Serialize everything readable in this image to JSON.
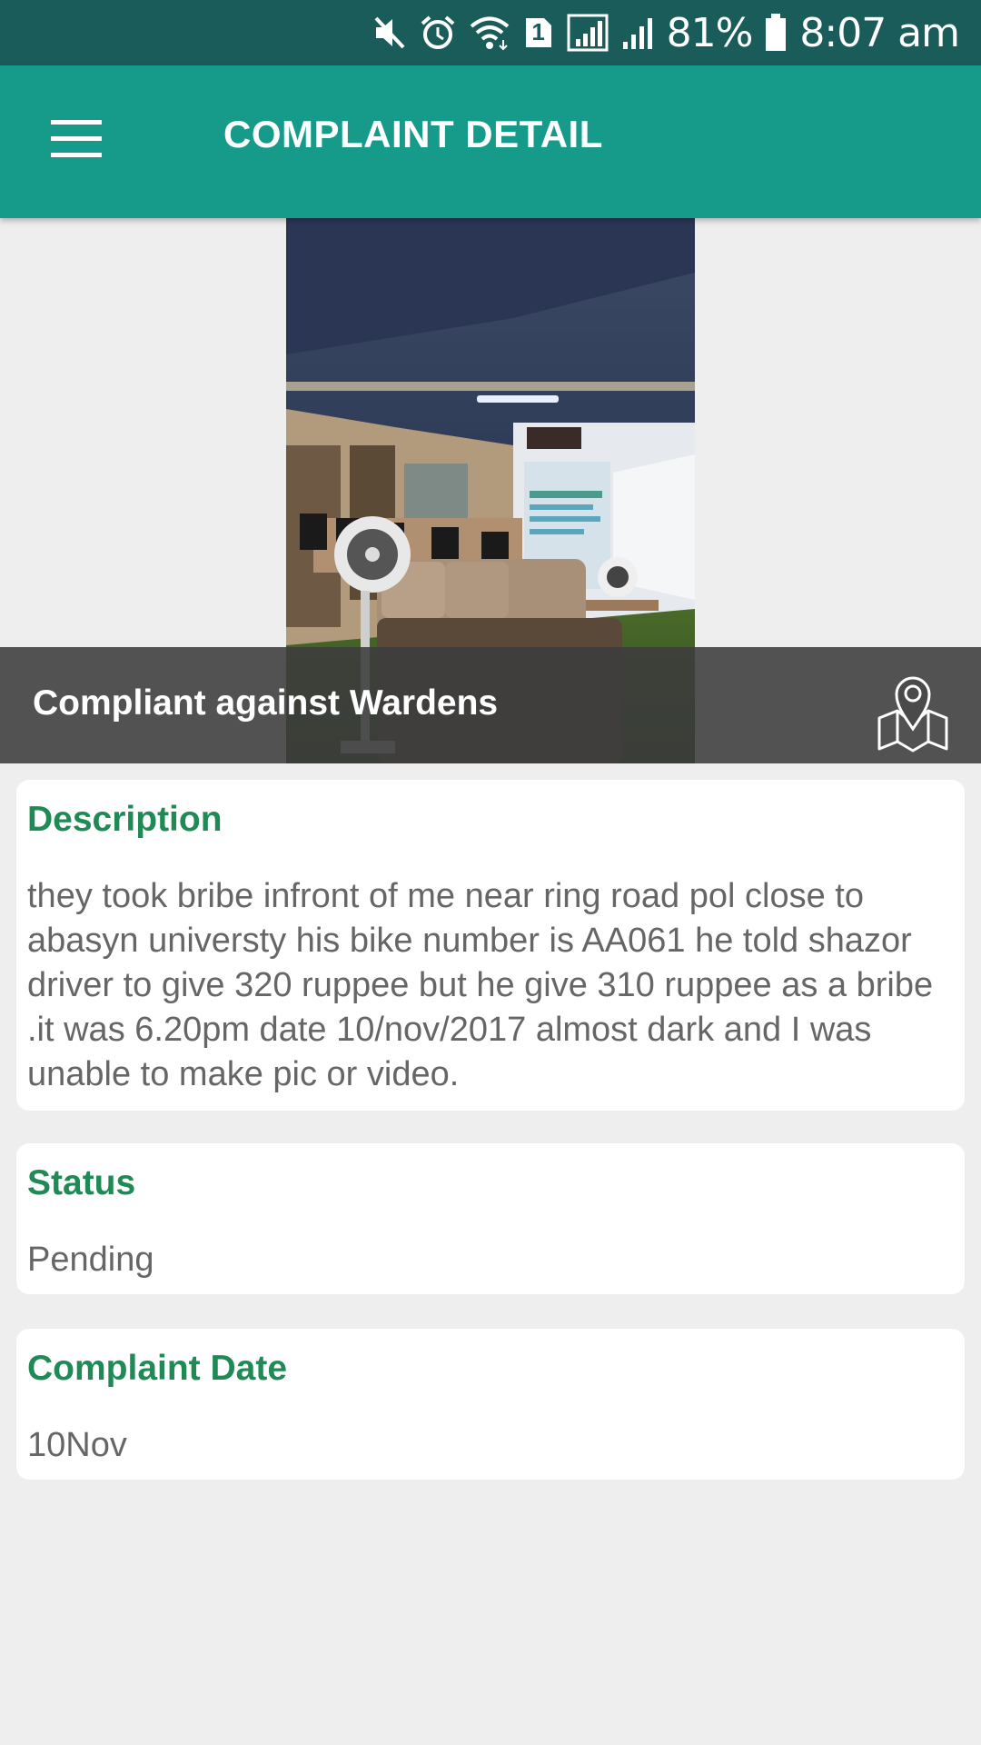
{
  "status_bar": {
    "battery": "81%",
    "time": "8:07 am",
    "sim_slot": "1",
    "icons": [
      "mute-icon",
      "alarm-icon",
      "wifi-icon",
      "sim-icon",
      "signal-icon",
      "signal-icon",
      "battery-icon"
    ]
  },
  "app_bar": {
    "title": "COMPLAINT DETAIL",
    "menu_icon": "hamburger-menu-icon",
    "color": "#169b8b"
  },
  "hero": {
    "title": "Compliant against Wardens",
    "map_icon": "map-location-icon"
  },
  "description": {
    "label": "Description",
    "text": "they took bribe infront of me near ring road pol close to abasyn universty his bike number is AA061 he told shazor driver to give 320 ruppee but he give 310 ruppee as a bribe .it was 6.20pm date 10/nov/2017 almost dark and I was unable to make pic or video."
  },
  "status": {
    "label": "Status",
    "value": "Pending"
  },
  "complaint_date": {
    "label": "Complaint Date",
    "value": "10Nov"
  },
  "colors": {
    "status_bar": "#1a5c5a",
    "accent": "#169b8b",
    "label_green": "#1f8a55"
  }
}
